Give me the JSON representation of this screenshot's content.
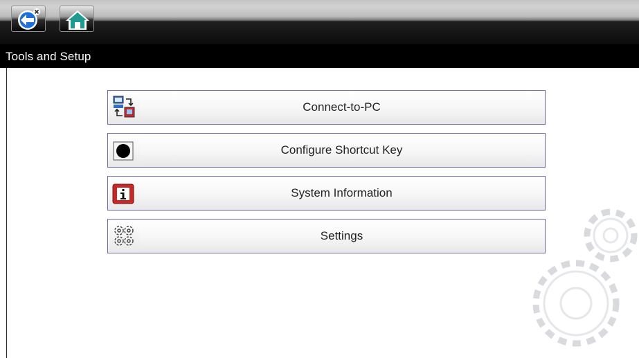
{
  "header": {
    "back_button": {
      "icon": "back-arrow-icon"
    },
    "home_button": {
      "icon": "home-icon"
    },
    "title": "Tools and Setup"
  },
  "menu": {
    "items": [
      {
        "label": "Connect-to-PC",
        "icon": "connect-to-pc-icon"
      },
      {
        "label": "Configure Shortcut Key",
        "icon": "shortcut-key-icon"
      },
      {
        "label": "System Information",
        "icon": "info-icon"
      },
      {
        "label": "Settings",
        "icon": "settings-icon"
      }
    ]
  },
  "background": {
    "watermark": "gears-watermark-icon"
  },
  "colors": {
    "title_bar": "#000000",
    "button_border": "#6a6b9c",
    "info_icon": "#c62828",
    "back_icon": "#1e6fd9",
    "home_icon": "#1f9a90"
  }
}
